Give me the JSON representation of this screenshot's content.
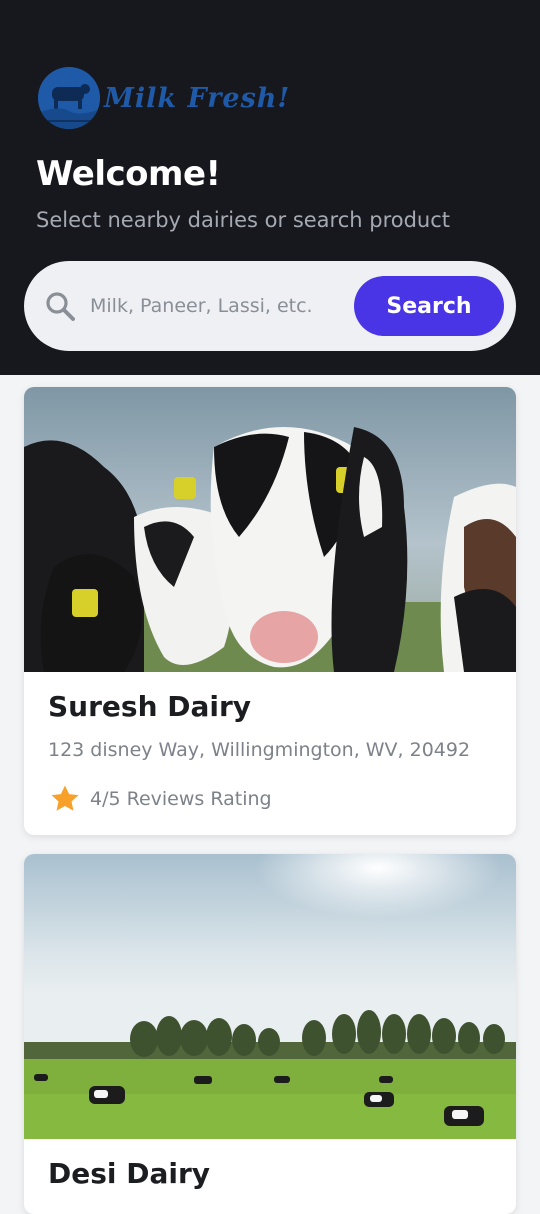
{
  "header": {
    "logo_text": "Milk Fresh!",
    "welcome": "Welcome!",
    "subtitle": "Select nearby dairies or search product"
  },
  "search": {
    "placeholder": "Milk, Paneer, Lassi, etc.",
    "value": "",
    "button_label": "Search",
    "icon": "search-icon"
  },
  "dairies": [
    {
      "name": "Suresh Dairy",
      "address": "123 disney Way, Willingmington, WV, 20492",
      "rating_text": "4/5 Reviews Rating",
      "rating": 4,
      "rating_max": 5,
      "image": "cows-closeup-photo"
    },
    {
      "name": "Desi Dairy",
      "image": "cows-grazing-field-photo"
    }
  ],
  "colors": {
    "header_bg": "#16181d",
    "accent": "#4a35e6",
    "star": "#f7a12b",
    "logo_blue": "#1f5aa8"
  }
}
